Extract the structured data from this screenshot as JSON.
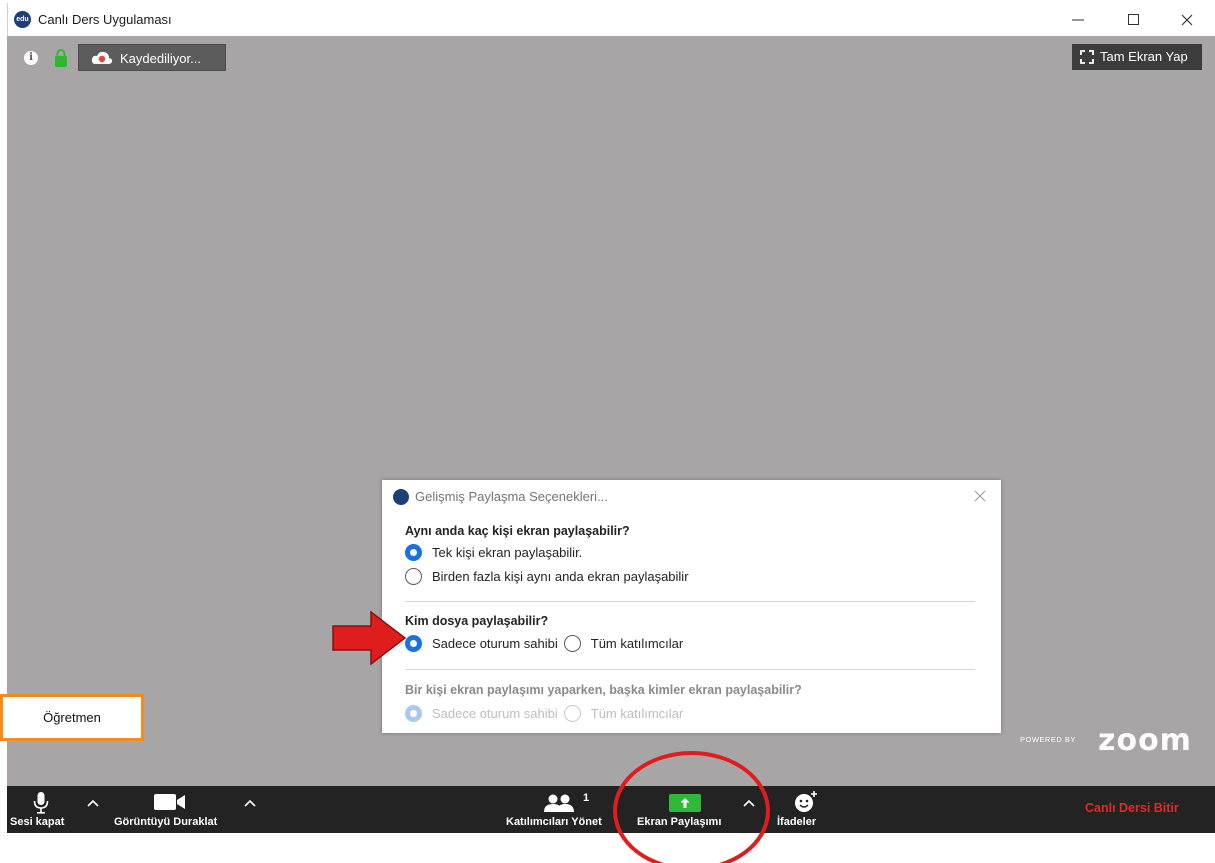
{
  "window": {
    "title": "Canlı Ders Uygulaması",
    "logo_text": "edu"
  },
  "status": {
    "recording_text": "Kaydediliyor...",
    "fullscreen_label": "Tam Ekran Yap"
  },
  "dialog": {
    "title": "Gelişmiş Paylaşma Seçenekleri...",
    "sections": [
      {
        "question": "Aynı anda kaç kişi ekran paylaşabilir?",
        "options": [
          {
            "label": "Tek kişi ekran paylaşabilir.",
            "selected": true
          },
          {
            "label": "Birden fazla kişi aynı anda ekran paylaşabilir",
            "selected": false
          }
        ]
      },
      {
        "question": "Kim dosya paylaşabilir?",
        "options": [
          {
            "label": "Sadece oturum sahibi",
            "selected": true
          },
          {
            "label": "Tüm katılımcılar",
            "selected": false
          }
        ]
      },
      {
        "question": "Bir kişi ekran paylaşımı yaparken, başka kimler ekran paylaşabilir?",
        "options": [
          {
            "label": "Sadece oturum sahibi",
            "selected": true
          },
          {
            "label": "Tüm katılımcılar",
            "selected": false
          }
        ]
      }
    ]
  },
  "video": {
    "participant_label": "Öğretmen",
    "powered_by": "POWERED BY",
    "brand": "zoom"
  },
  "toolbar": {
    "mute_label": "Sesi kapat",
    "video_label": "Görüntüyü Duraklat",
    "participants_label": "Katılımcıları Yönet",
    "participants_count": "1",
    "share_label": "Ekran Paylaşımı",
    "reactions_label": "İfadeler",
    "end_label": "Canlı Dersi Bitir"
  },
  "colors": {
    "video_bg": "#a8a5a6",
    "toolbar_bg": "#232323",
    "share_green": "#2fb83a",
    "radio_blue": "#1a72e0",
    "end_red": "#e8262a",
    "annotation_red": "#e01d1d",
    "teacher_border": "#f28c1e"
  }
}
